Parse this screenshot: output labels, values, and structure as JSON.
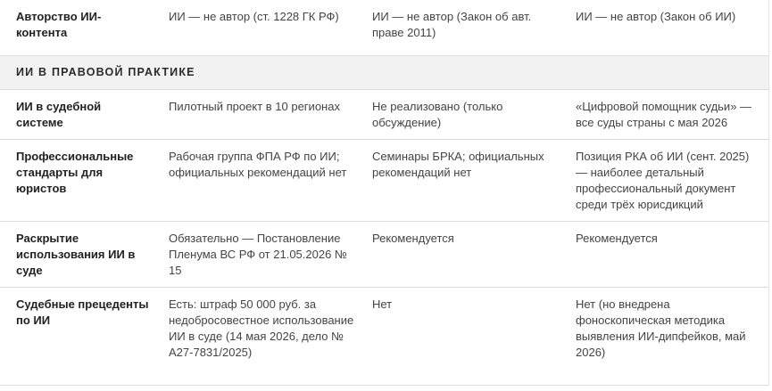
{
  "rows_top": [
    {
      "label": "Авторство ИИ-контента",
      "col1": "ИИ — не автор (ст. 1228 ГК РФ)",
      "col2": "ИИ — не автор (Закон об авт. праве 2011)",
      "col3": "ИИ — не автор (Закон об ИИ)"
    }
  ],
  "section": {
    "title": "ИИ В ПРАВОВОЙ ПРАКТИКЕ"
  },
  "rows": [
    {
      "label": "ИИ в судебной системе",
      "col1": "Пилотный проект в 10 регионах",
      "col2": "Не реализовано (только обсуждение)",
      "col3": "«Цифровой помощник судьи» — все суды страны с мая 2026"
    },
    {
      "label": "Профессиональные стандарты для юристов",
      "col1": "Рабочая группа ФПА РФ по ИИ; официальных рекомендаций нет",
      "col2": "Семинары БРКА; официальных рекомендаций нет",
      "col3": "Позиция РКА об ИИ (сент. 2025) — наиболее детальный профессиональный документ среди трёх юрисдикций"
    },
    {
      "label": "Раскрытие использования ИИ в суде",
      "col1": "Обязательно — Постановление Пленума ВС РФ от 21.05.2026 № 15",
      "col2": "Рекомендуется",
      "col3": "Рекомендуется"
    },
    {
      "label": "Судебные прецеденты по ИИ",
      "col1": "Есть: штраф 50 000 руб. за недобросовестное использование ИИ в суде (14 мая 2026, дело № А27-7831/2025)",
      "col2": "Нет",
      "col3": "Нет (но внедрена фоноскопическая методика выявления ИИ-дипфейков, май 2026)"
    }
  ]
}
